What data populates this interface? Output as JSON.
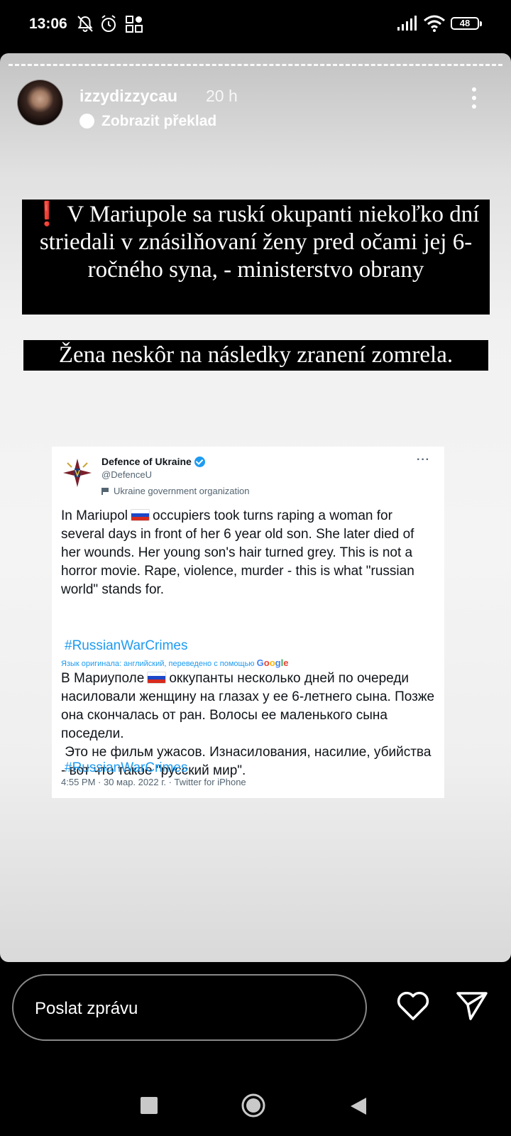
{
  "status_bar": {
    "time": "13:06",
    "battery": "48",
    "icons": [
      "bell-muted-icon",
      "alarm-icon",
      "apps-icon",
      "signal-icon",
      "wifi-icon",
      "battery-icon"
    ]
  },
  "story": {
    "username": "izzydizzycau",
    "age": "20 h",
    "translate_label": "Zobrazit překlad",
    "caption_mark": "❗",
    "caption_main": "V Mariupole sa ruskí okupanti niekoľko dní striedali v znásilňovaní ženy pred očami jej 6-ročného syna, - ministerstvo obrany",
    "caption_second": "Žena neskôr na následky zranení zomrela."
  },
  "tweet": {
    "name": "Defence of Ukraine",
    "handle": "@DefenceU",
    "org_label": "Ukraine government organization",
    "more": "···",
    "text_before_flag": "In Mariupol",
    "text_after_flag": "occupiers took turns raping a woman for several days in front of her 6 year old son. She later died of her wounds. Her young son's hair turned grey. This is not a horror movie. Rape, violence, murder - this is what \"russian world\" stands for.",
    "hashtag": "#RussianWarCrimes",
    "translation_note": "Язык оригинала: английский, переведено с помощью",
    "translation_brand": [
      "G",
      "o",
      "o",
      "g",
      "l",
      "e"
    ],
    "ru_before_flag": "В Мариуполе",
    "ru_after_flag": "оккупанты несколько дней по очереди насиловали женщину на глазах у ее 6-летнего сына. Позже она скончалась от ран. Волосы ее маленького сына поседели.",
    "ru_second": "Это не фильм ужасов. Изнасилования, насилие, убийства - вот что такое \"русский мир\".",
    "ru_hashtag": "#RussianWarCrimes",
    "meta": "4:55 PM · 30 мар. 2022 г. · Twitter for iPhone"
  },
  "bottom_bar": {
    "message_placeholder": "Poslat zprávu"
  },
  "colors": {
    "background": "#000000",
    "caption_bg": "#000000",
    "alert_red": "#e0162b",
    "link_blue": "#1d9bf0",
    "russian_flag": [
      "#ffffff",
      "#1c47c8",
      "#d52b1e"
    ]
  }
}
